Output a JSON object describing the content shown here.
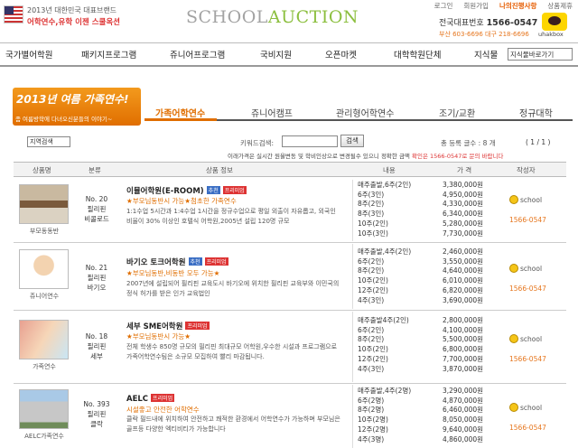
{
  "header": {
    "award_line1": "2013년 대한민국 대표브랜드",
    "award_line2": "어학연수,유학 이젠 스쿨옥션",
    "logo_part1": "SCHOOL",
    "logo_part2": "AUCTION",
    "top_links": [
      "로그인",
      "회원가입",
      "나의진행사항",
      "상품제휴"
    ],
    "rep_label": "전국대표번호",
    "rep_number": "1566-0547",
    "branches": "부산 603-6696  대구 218-6696",
    "talk_label": "uhakbox"
  },
  "nav": {
    "items": [
      "국가별어학원",
      "패키지프로그램",
      "쥬니어프로그램",
      "국비지원",
      "오픈마켓",
      "대학학원단체",
      "지식물"
    ],
    "shortcut_value": "지식물바로가기"
  },
  "banner": {
    "title": "2013년 여름 가족연수!",
    "subtitle": "좀 여름방학에 다녀오신분들의 이야기~"
  },
  "tabs": [
    "가족어학연수",
    "쥬니어캠프",
    "관리형어학연수",
    "조기/교환",
    "정규대학"
  ],
  "search": {
    "region_value": "지역검색",
    "keyword_label": "키워드검색:",
    "keyword_value": "",
    "button_label": "검색",
    "total_label": "총 등록 글수 : 8 개",
    "paging": "( 1 / 1 )",
    "notice_main": "이래가격은 실시간 원율변동 및 학비인상으로 변경될수 있으니 정확한 금액 ",
    "notice_red": "확인은 1566-0547로 문의 바랍니다"
  },
  "table": {
    "headers": [
      "상품명",
      "분류",
      "상품 정보",
      "내용",
      "가 격",
      "작성자"
    ],
    "rows": [
      {
        "caption": "부모동동반",
        "code": [
          "No. 20",
          "필리핀",
          "비콜로드"
        ],
        "title": "이뮬어학원(E-ROOM)",
        "badges": [
          "추천",
          "프리미엄"
        ],
        "promo": "★부모님동반시 가능★첨초한 가족연수",
        "desc": "1:1수업 5시간과 1:4수업 1시간을 정규수업으로 평일 외출이 자유롭고, 외국인 비율이 30% 이상인 호텔식 어학원,2005년 설립 120명 규모",
        "durations": [
          "매주출발,6주(2인)",
          "6주(3인)",
          "8주(2인)",
          "8주(3인)",
          "10주(2인)",
          "10주(3인)"
        ],
        "prices": [
          "3,380,000원",
          "4,950,000원",
          "4,330,000원",
          "6,340,000원",
          "5,280,000원",
          "7,730,000원"
        ],
        "writer": "school",
        "phone": "1566-0547"
      },
      {
        "caption": "쥬니어연수",
        "code": [
          "No. 21",
          "필리핀",
          "바기오"
        ],
        "title": "바기오 토크어학원",
        "badges": [
          "추천",
          "프리미엄"
        ],
        "promo": "★부모님동반,비동반 모두 가능★",
        "desc": "2007년에 설립되어 필리핀 교육도시 바기오에 위치한 필리핀 교육부와 이민국의 정식 허가를 받은 인가 교육법인",
        "durations": [
          "매주출발,4주(2인)",
          "6주(2인)",
          "8주(2인)",
          "10주(2인)",
          "12주(2인)",
          "4주(3인)"
        ],
        "prices": [
          "2,460,000원",
          "3,550,000원",
          "4,640,000원",
          "6,010,000원",
          "6,820,000원",
          "3,690,000원"
        ],
        "writer": "school",
        "phone": "1566-0547"
      },
      {
        "caption": "가족연수",
        "code": [
          "No. 18",
          "필리핀",
          "세부"
        ],
        "title": "세부 SME어학원",
        "badges": [
          "프리미엄"
        ],
        "promo": "★부모님동반시 가능★",
        "desc": "전체 학생수 850명 규모의 필리핀 최대규모 어학원,우수한 시설과 프로그램으로 가족어학연수팀은 소규모 모집하여 빨리 마감됩니다.",
        "durations": [
          "매주출발4주(2인)",
          "6주(2인)",
          "8주(2인)",
          "10주(2인)",
          "12주(2인)",
          "4주(3인)"
        ],
        "prices": [
          "2,800,000원",
          "4,100,000원",
          "5,500,000원",
          "6,800,000원",
          "7,700,000원",
          "3,870,000원"
        ],
        "writer": "school",
        "phone": "1566-0547"
      },
      {
        "caption": "AELC가족연수",
        "code": [
          "No. 393",
          "필리핀",
          "클락"
        ],
        "title": "AELC",
        "badges": [
          "프리미엄"
        ],
        "promo": "시설좋고 안전한 어학연수",
        "desc": "클락 필드내에 위치하여 안전하고 쾌적한 환경에서 어학연수가 가능하며 부모님은 골프등 다양한 엑티비티가 가능합니다",
        "durations": [
          "매주출발,4주(2명)",
          "6주(2명)",
          "8주(2명)",
          "10주(2명)",
          "12주(2명)",
          "4주(3명)"
        ],
        "prices": [
          "3,290,000원",
          "4,870,000원",
          "6,460,000원",
          "8,050,000원",
          "9,640,000원",
          "4,860,000원"
        ],
        "writer": "school",
        "phone": "1566-0547"
      }
    ]
  }
}
